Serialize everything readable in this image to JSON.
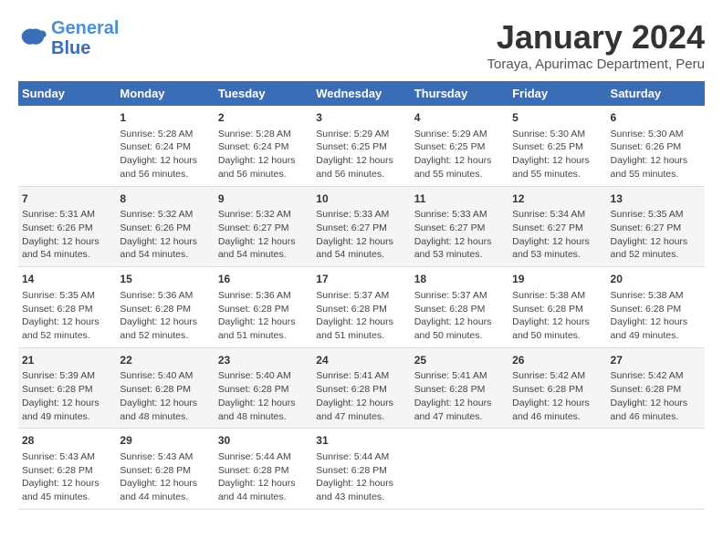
{
  "header": {
    "logo_line1": "General",
    "logo_line2": "Blue",
    "title": "January 2024",
    "subtitle": "Toraya, Apurimac Department, Peru"
  },
  "days_of_week": [
    "Sunday",
    "Monday",
    "Tuesday",
    "Wednesday",
    "Thursday",
    "Friday",
    "Saturday"
  ],
  "weeks": [
    [
      {
        "day": "",
        "info": ""
      },
      {
        "day": "1",
        "info": "Sunrise: 5:28 AM\nSunset: 6:24 PM\nDaylight: 12 hours\nand 56 minutes."
      },
      {
        "day": "2",
        "info": "Sunrise: 5:28 AM\nSunset: 6:24 PM\nDaylight: 12 hours\nand 56 minutes."
      },
      {
        "day": "3",
        "info": "Sunrise: 5:29 AM\nSunset: 6:25 PM\nDaylight: 12 hours\nand 56 minutes."
      },
      {
        "day": "4",
        "info": "Sunrise: 5:29 AM\nSunset: 6:25 PM\nDaylight: 12 hours\nand 55 minutes."
      },
      {
        "day": "5",
        "info": "Sunrise: 5:30 AM\nSunset: 6:25 PM\nDaylight: 12 hours\nand 55 minutes."
      },
      {
        "day": "6",
        "info": "Sunrise: 5:30 AM\nSunset: 6:26 PM\nDaylight: 12 hours\nand 55 minutes."
      }
    ],
    [
      {
        "day": "7",
        "info": "Sunrise: 5:31 AM\nSunset: 6:26 PM\nDaylight: 12 hours\nand 54 minutes."
      },
      {
        "day": "8",
        "info": "Sunrise: 5:32 AM\nSunset: 6:26 PM\nDaylight: 12 hours\nand 54 minutes."
      },
      {
        "day": "9",
        "info": "Sunrise: 5:32 AM\nSunset: 6:27 PM\nDaylight: 12 hours\nand 54 minutes."
      },
      {
        "day": "10",
        "info": "Sunrise: 5:33 AM\nSunset: 6:27 PM\nDaylight: 12 hours\nand 54 minutes."
      },
      {
        "day": "11",
        "info": "Sunrise: 5:33 AM\nSunset: 6:27 PM\nDaylight: 12 hours\nand 53 minutes."
      },
      {
        "day": "12",
        "info": "Sunrise: 5:34 AM\nSunset: 6:27 PM\nDaylight: 12 hours\nand 53 minutes."
      },
      {
        "day": "13",
        "info": "Sunrise: 5:35 AM\nSunset: 6:27 PM\nDaylight: 12 hours\nand 52 minutes."
      }
    ],
    [
      {
        "day": "14",
        "info": "Sunrise: 5:35 AM\nSunset: 6:28 PM\nDaylight: 12 hours\nand 52 minutes."
      },
      {
        "day": "15",
        "info": "Sunrise: 5:36 AM\nSunset: 6:28 PM\nDaylight: 12 hours\nand 52 minutes."
      },
      {
        "day": "16",
        "info": "Sunrise: 5:36 AM\nSunset: 6:28 PM\nDaylight: 12 hours\nand 51 minutes."
      },
      {
        "day": "17",
        "info": "Sunrise: 5:37 AM\nSunset: 6:28 PM\nDaylight: 12 hours\nand 51 minutes."
      },
      {
        "day": "18",
        "info": "Sunrise: 5:37 AM\nSunset: 6:28 PM\nDaylight: 12 hours\nand 50 minutes."
      },
      {
        "day": "19",
        "info": "Sunrise: 5:38 AM\nSunset: 6:28 PM\nDaylight: 12 hours\nand 50 minutes."
      },
      {
        "day": "20",
        "info": "Sunrise: 5:38 AM\nSunset: 6:28 PM\nDaylight: 12 hours\nand 49 minutes."
      }
    ],
    [
      {
        "day": "21",
        "info": "Sunrise: 5:39 AM\nSunset: 6:28 PM\nDaylight: 12 hours\nand 49 minutes."
      },
      {
        "day": "22",
        "info": "Sunrise: 5:40 AM\nSunset: 6:28 PM\nDaylight: 12 hours\nand 48 minutes."
      },
      {
        "day": "23",
        "info": "Sunrise: 5:40 AM\nSunset: 6:28 PM\nDaylight: 12 hours\nand 48 minutes."
      },
      {
        "day": "24",
        "info": "Sunrise: 5:41 AM\nSunset: 6:28 PM\nDaylight: 12 hours\nand 47 minutes."
      },
      {
        "day": "25",
        "info": "Sunrise: 5:41 AM\nSunset: 6:28 PM\nDaylight: 12 hours\nand 47 minutes."
      },
      {
        "day": "26",
        "info": "Sunrise: 5:42 AM\nSunset: 6:28 PM\nDaylight: 12 hours\nand 46 minutes."
      },
      {
        "day": "27",
        "info": "Sunrise: 5:42 AM\nSunset: 6:28 PM\nDaylight: 12 hours\nand 46 minutes."
      }
    ],
    [
      {
        "day": "28",
        "info": "Sunrise: 5:43 AM\nSunset: 6:28 PM\nDaylight: 12 hours\nand 45 minutes."
      },
      {
        "day": "29",
        "info": "Sunrise: 5:43 AM\nSunset: 6:28 PM\nDaylight: 12 hours\nand 44 minutes."
      },
      {
        "day": "30",
        "info": "Sunrise: 5:44 AM\nSunset: 6:28 PM\nDaylight: 12 hours\nand 44 minutes."
      },
      {
        "day": "31",
        "info": "Sunrise: 5:44 AM\nSunset: 6:28 PM\nDaylight: 12 hours\nand 43 minutes."
      },
      {
        "day": "",
        "info": ""
      },
      {
        "day": "",
        "info": ""
      },
      {
        "day": "",
        "info": ""
      }
    ]
  ]
}
